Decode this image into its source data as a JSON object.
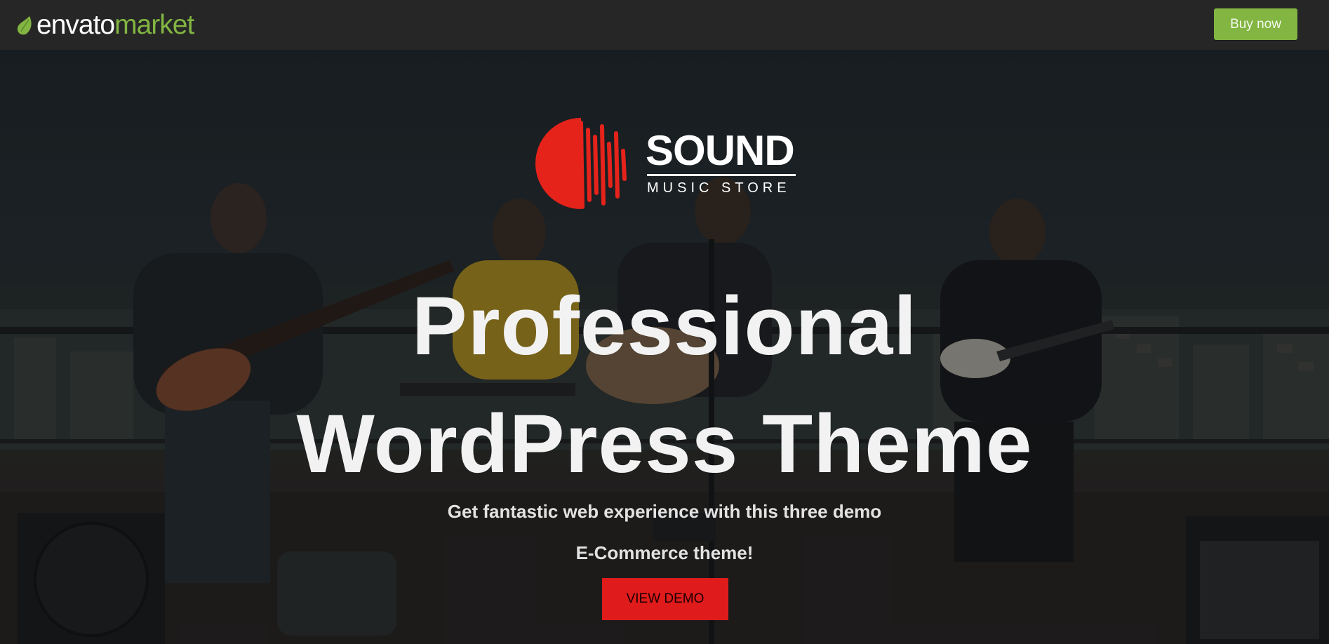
{
  "header": {
    "brand_word1": "envato",
    "brand_word2": "market",
    "buy_label": "Buy now"
  },
  "hero": {
    "logo_title": "SOUND",
    "logo_subtitle": "MUSIC STORE",
    "headline_line1": "Professional",
    "headline_line2": "WordPress Theme",
    "subline_line1": "Get fantastic web experience with this three demo",
    "subline_line2": "E-Commerce theme!",
    "demo_label": "VIEW DEMO"
  },
  "colors": {
    "topbar": "#262626",
    "brand_green": "#82b541",
    "accent_red": "#e01b1b"
  },
  "icons": {
    "brand": "envato-leaf-icon",
    "logo": "sound-wave-icon"
  }
}
